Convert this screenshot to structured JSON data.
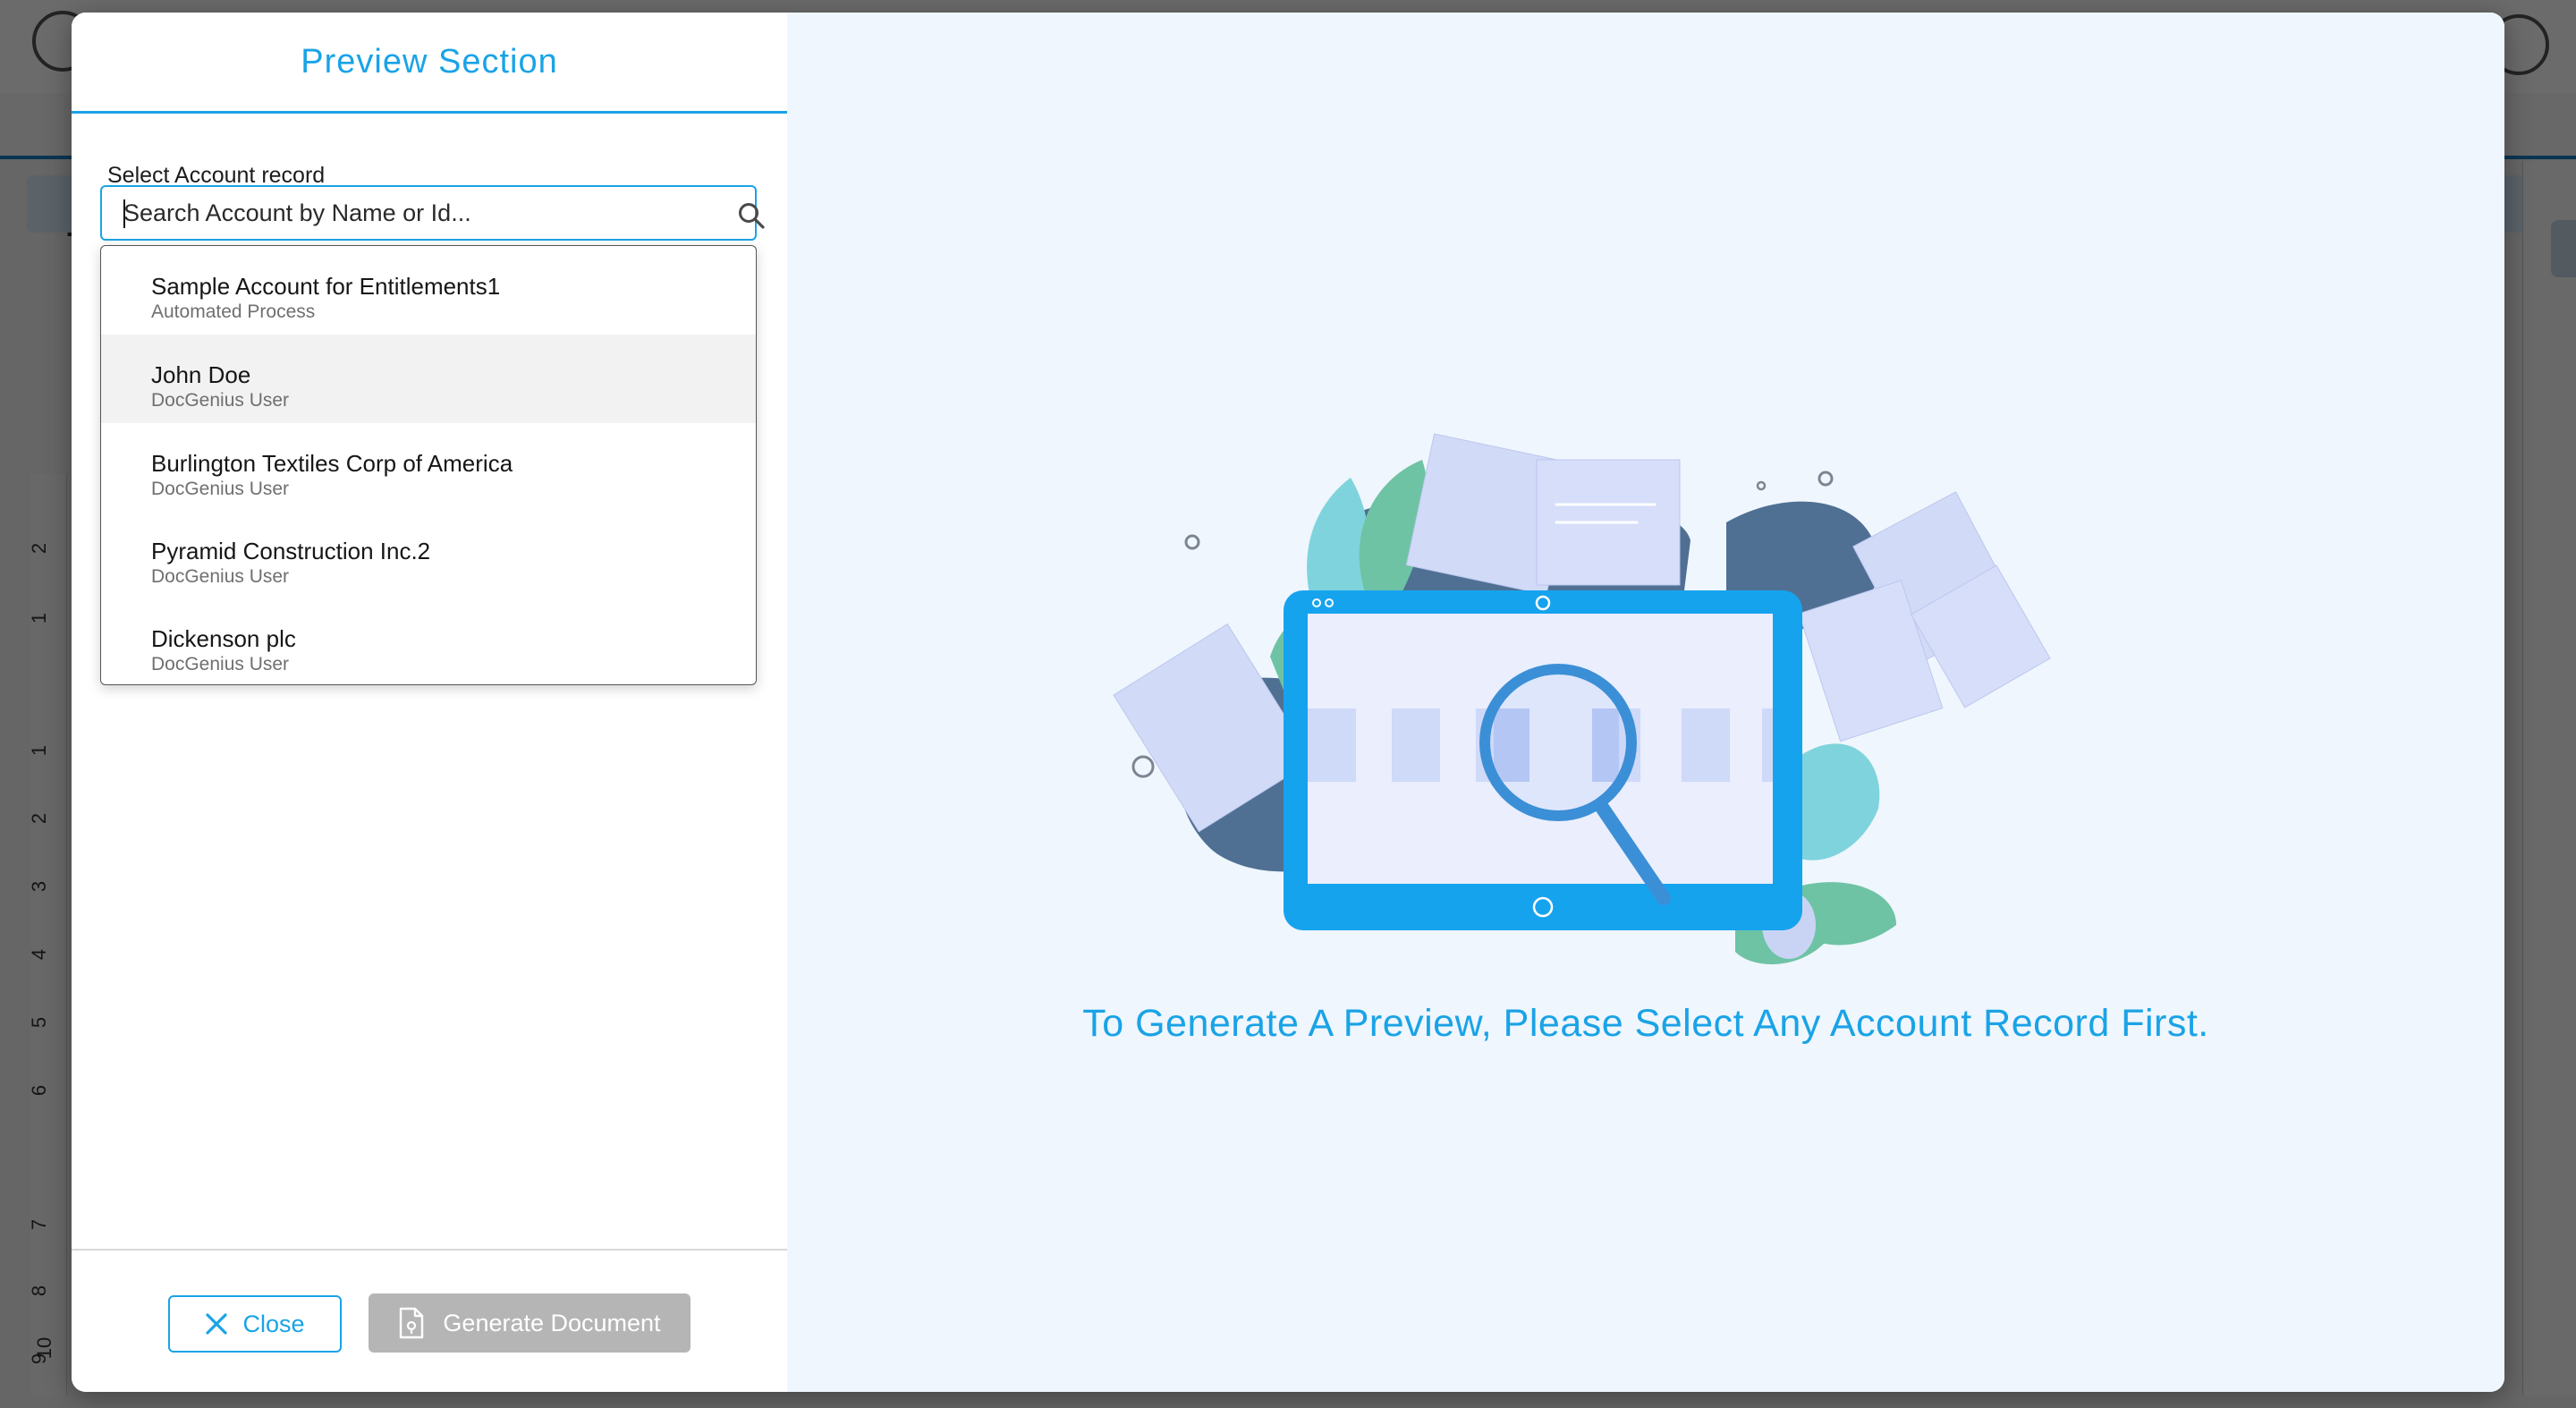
{
  "modal": {
    "title": "Preview Section",
    "field_label": "Select Account record",
    "search": {
      "placeholder": "Search Account by Name or Id...",
      "value": ""
    },
    "results": [
      {
        "name": "Sample Account for Entitlements1",
        "owner": "Automated Process"
      },
      {
        "name": "John Doe",
        "owner": "DocGenius User"
      },
      {
        "name": "Burlington Textiles Corp of America",
        "owner": "DocGenius User"
      },
      {
        "name": "Pyramid Construction Inc.2",
        "owner": "DocGenius User"
      },
      {
        "name": "Dickenson plc",
        "owner": "DocGenius User"
      }
    ],
    "hovered_result": "John Doe",
    "buttons": {
      "close": "Close",
      "generate": "Generate Document"
    },
    "preview_message": "To Generate A Preview, Please Select Any Account Record First."
  },
  "background": {
    "ruler_labels": [
      "2",
      "1",
      "1",
      "2",
      "3",
      "4",
      "5",
      "6",
      "7",
      "8",
      "9",
      "10"
    ]
  },
  "colors": {
    "accent": "#1aa3e6",
    "disabled_button": "#b5b5b5",
    "preview_background": "#eff6fd",
    "hover_row": "#f2f2f2"
  },
  "icons": {
    "search": "search-icon",
    "close": "close-x-icon",
    "generate": "document-icon",
    "illustration": "tablet-magnifier-documents-illustration"
  }
}
